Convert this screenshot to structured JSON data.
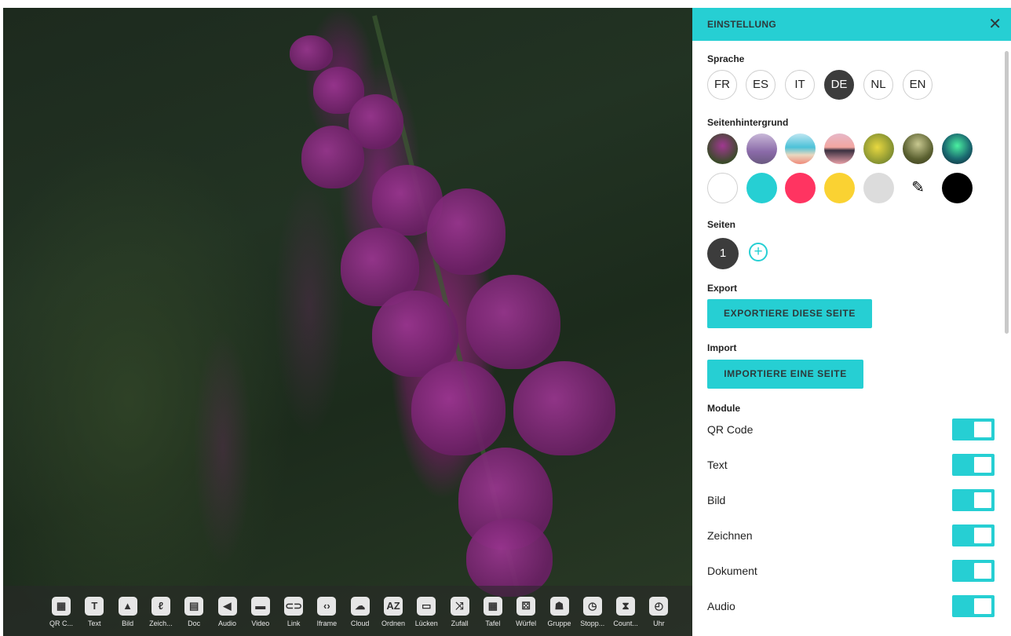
{
  "panel": {
    "title": "EINSTELLUNG",
    "close_icon": "close-icon",
    "sections": {
      "language": "Sprache",
      "background": "Seitenhintergrund",
      "pages": "Seiten",
      "export": "Export",
      "import": "Import",
      "modules": "Module"
    },
    "languages": [
      {
        "code": "FR",
        "active": false
      },
      {
        "code": "ES",
        "active": false
      },
      {
        "code": "IT",
        "active": false
      },
      {
        "code": "DE",
        "active": true
      },
      {
        "code": "NL",
        "active": false
      },
      {
        "code": "EN",
        "active": false
      }
    ],
    "background_images": [
      "foxglove",
      "lavender",
      "beach",
      "lake-sunset",
      "mimosa",
      "tree",
      "aurora"
    ],
    "background_colors": [
      "#ffffff",
      "#26cfd3",
      "#ff3461",
      "#fad232",
      "#dcdcdc",
      "eyedropper",
      "#000000"
    ],
    "pages": {
      "current": "1",
      "add_icon": "plus-circle-icon"
    },
    "export_button": "EXPORTIERE DIESE SEITE",
    "import_button": "IMPORTIERE EINE SEITE",
    "modules": [
      {
        "name": "QR Code",
        "enabled": true
      },
      {
        "name": "Text",
        "enabled": true
      },
      {
        "name": "Bild",
        "enabled": true
      },
      {
        "name": "Zeichnen",
        "enabled": true
      },
      {
        "name": "Dokument",
        "enabled": true
      },
      {
        "name": "Audio",
        "enabled": true
      }
    ],
    "accent_color": "#26cfd3"
  },
  "toolbar": {
    "tools": [
      {
        "label": "QR C...",
        "icon": "qr-icon",
        "glyph": "▦"
      },
      {
        "label": "Text",
        "icon": "text-icon",
        "glyph": "T"
      },
      {
        "label": "Bild",
        "icon": "image-icon",
        "glyph": "▲"
      },
      {
        "label": "Zeich...",
        "icon": "draw-icon",
        "glyph": "ℓ"
      },
      {
        "label": "Doc",
        "icon": "document-icon",
        "glyph": "▤"
      },
      {
        "label": "Audio",
        "icon": "audio-icon",
        "glyph": "◀"
      },
      {
        "label": "Video",
        "icon": "video-icon",
        "glyph": "▬"
      },
      {
        "label": "Link",
        "icon": "link-icon",
        "glyph": "⊂⊃"
      },
      {
        "label": "Iframe",
        "icon": "code-icon",
        "glyph": "‹›"
      },
      {
        "label": "Cloud",
        "icon": "cloud-icon",
        "glyph": "☁"
      },
      {
        "label": "Ordnen",
        "icon": "sort-icon",
        "glyph": "AZ"
      },
      {
        "label": "Lücken",
        "icon": "gap-icon",
        "glyph": "▭"
      },
      {
        "label": "Zufall",
        "icon": "shuffle-icon",
        "glyph": "⤨"
      },
      {
        "label": "Tafel",
        "icon": "table-icon",
        "glyph": "▦"
      },
      {
        "label": "Würfel",
        "icon": "dice-icon",
        "glyph": "⚄"
      },
      {
        "label": "Gruppe",
        "icon": "group-icon",
        "glyph": "☗"
      },
      {
        "label": "Stopp...",
        "icon": "stopwatch-icon",
        "glyph": "◷"
      },
      {
        "label": "Count...",
        "icon": "hourglass-icon",
        "glyph": "⧗"
      },
      {
        "label": "Uhr",
        "icon": "clock-icon",
        "glyph": "◴"
      }
    ]
  }
}
